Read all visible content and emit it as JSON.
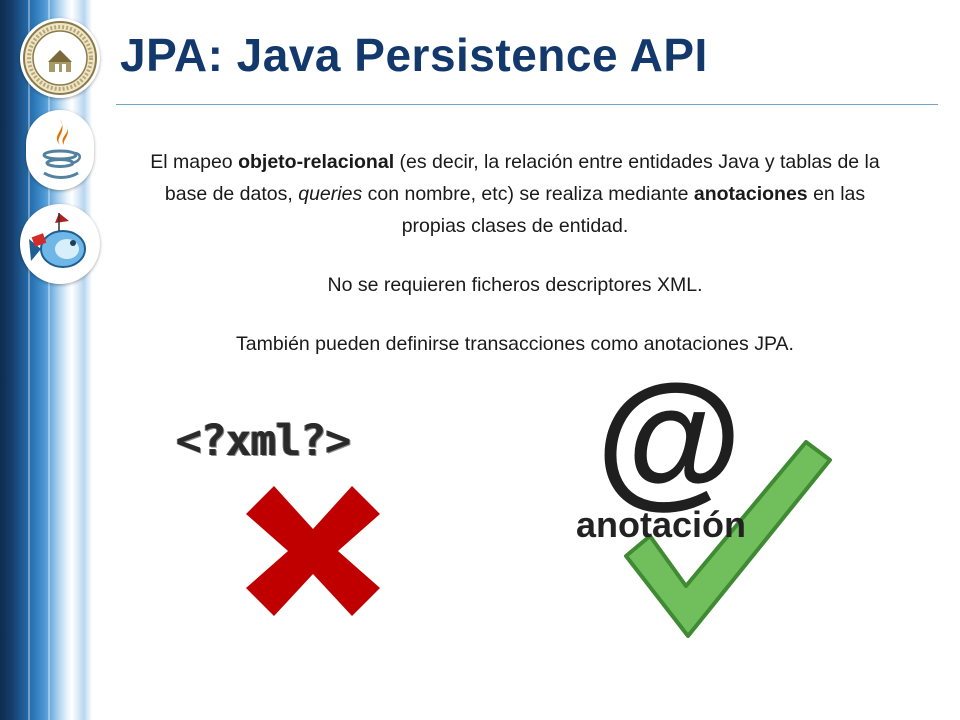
{
  "slide": {
    "title": "JPA: Java Persistence API",
    "paragraph1": [
      {
        "text": "El mapeo ",
        "style": "normal"
      },
      {
        "text": "objeto-relacional",
        "style": "bold"
      },
      {
        "text": " (es decir, la relación entre entidades Java y tablas de la base de datos, ",
        "style": "normal"
      },
      {
        "text": "queries",
        "style": "italic"
      },
      {
        "text": " con nombre, etc) se realiza mediante ",
        "style": "normal"
      },
      {
        "text": "anotaciones",
        "style": "bold"
      },
      {
        "text": " en las propias clases de entidad.",
        "style": "normal"
      }
    ],
    "paragraph2": "No se requieren ficheros descriptores XML.",
    "paragraph3": "También pueden definirse transacciones como anotaciones JPA."
  },
  "illustration": {
    "xml_label": "<?xml?>",
    "at_symbol": "@",
    "annotation_label": "anotación",
    "reject_icon": "red-x-icon",
    "accept_icon": "green-checkmark-icon",
    "reject_color": "#c00000",
    "accept_color": "#70bf5c"
  },
  "sidebar": {
    "logos": [
      "university-seal-logo",
      "java-logo",
      "glassfish-logo"
    ]
  },
  "theme": {
    "title_color": "#13386b",
    "rule_color": "#6fa6c9"
  }
}
